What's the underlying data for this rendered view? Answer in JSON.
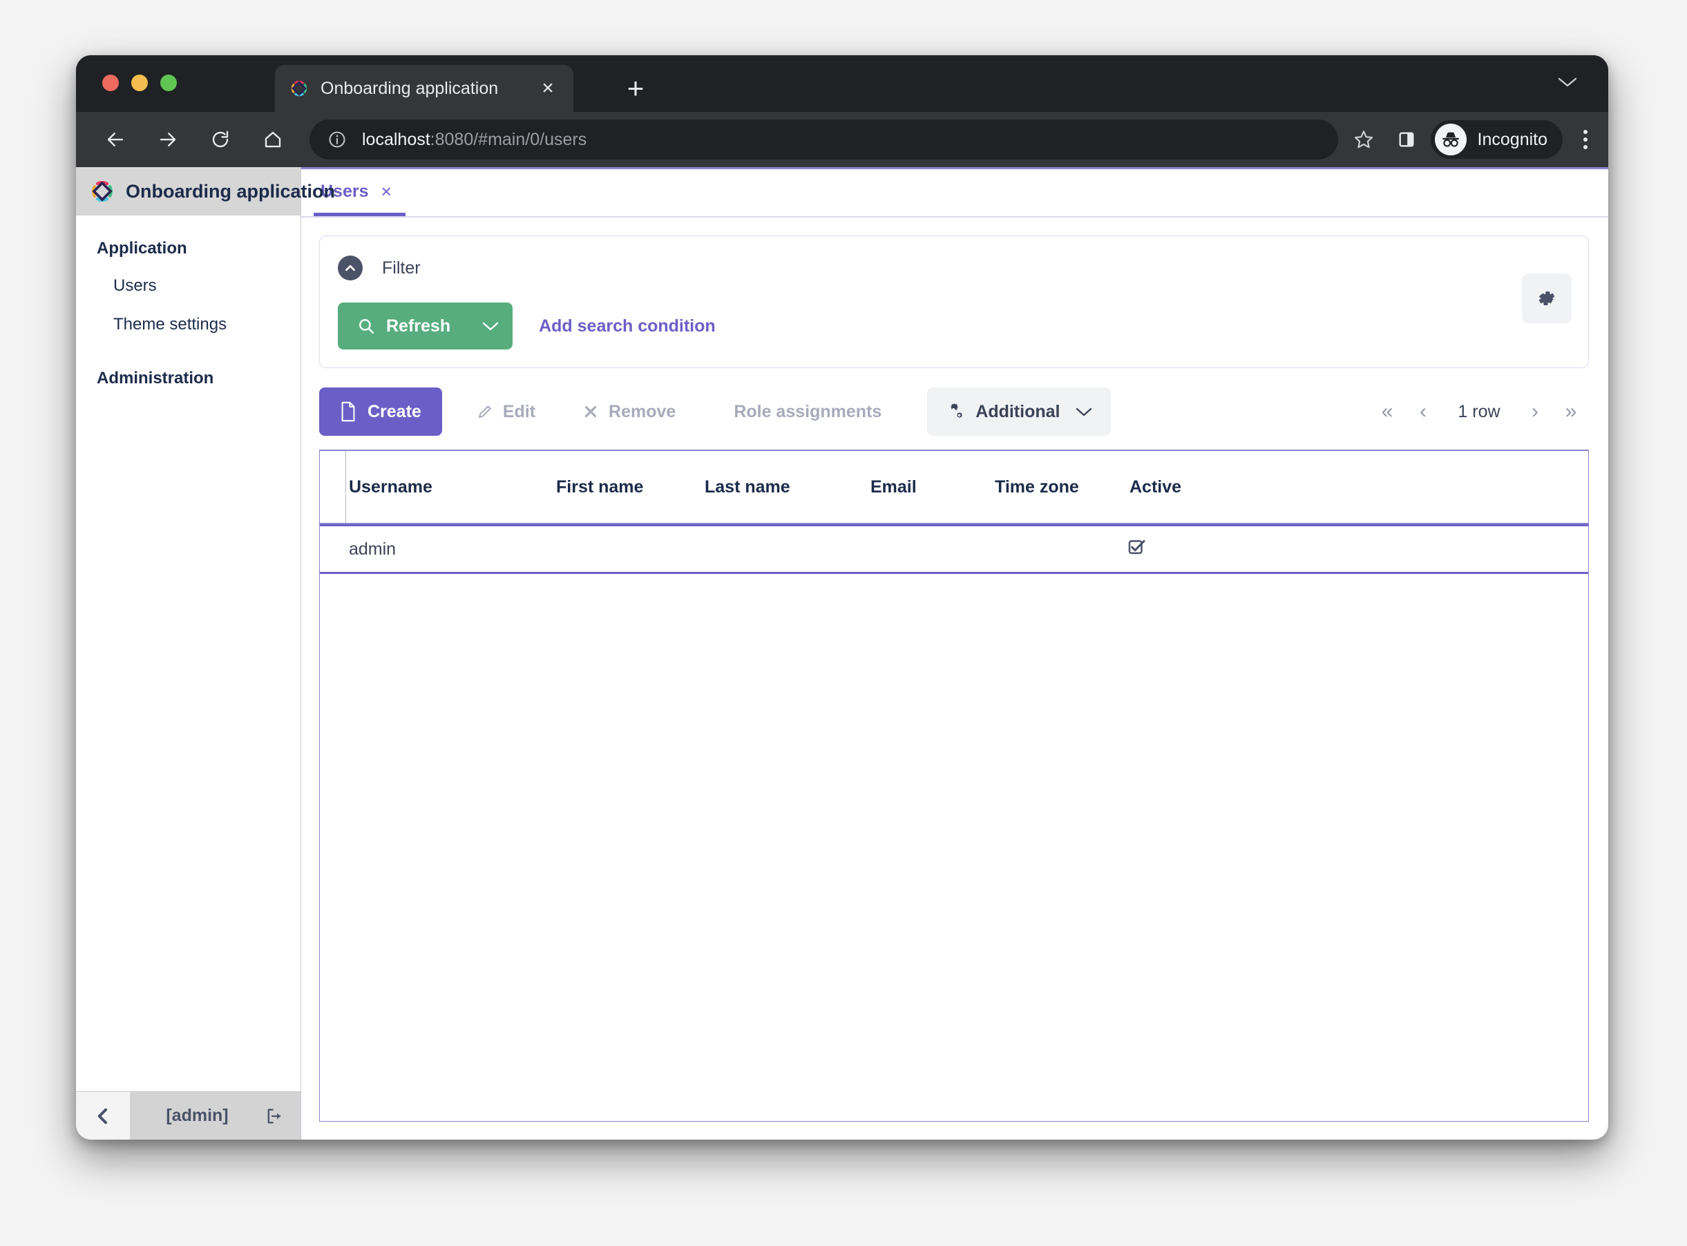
{
  "browser": {
    "tab": {
      "title": "Onboarding application",
      "close_label": "×",
      "favicon": "app-diamond-logo-icon"
    },
    "new_tab_label": "+",
    "tabstrip_menu_icon": "chevron-down-icon",
    "nav": {
      "back_icon": "back-arrow-icon",
      "forward_icon": "forward-arrow-icon",
      "reload_icon": "reload-icon",
      "home_icon": "home-icon"
    },
    "omnibox": {
      "info_icon": "site-info-icon",
      "url_host": "localhost",
      "url_rest": ":8080/#main/0/users",
      "url_full": "localhost:8080/#main/0/users"
    },
    "star_icon": "bookmark-star-icon",
    "split_icon": "side-panel-icon",
    "profile": {
      "label": "Incognito",
      "icon": "incognito-icon"
    },
    "menu_icon": "kebab-menu-icon"
  },
  "sidebar": {
    "app_title": "Onboarding application",
    "logo_icon": "app-diamond-logo-icon",
    "groups": [
      {
        "title": "Application",
        "items": [
          {
            "label": "Users"
          },
          {
            "label": "Theme settings"
          }
        ]
      },
      {
        "title": "Administration",
        "items": []
      }
    ],
    "footer": {
      "collapse_icon": "chevron-left-icon",
      "user_label": "[admin]",
      "logout_icon": "logout-icon"
    }
  },
  "content": {
    "tabs": [
      {
        "label": "Users",
        "close_label": "×",
        "active": true
      }
    ],
    "filter": {
      "title": "Filter",
      "collapse_icon": "chevron-up-circle-icon",
      "refresh_label": "Refresh",
      "refresh_icon": "search-icon",
      "refresh_caret_icon": "chevron-down-icon",
      "add_condition_label": "Add search condition",
      "settings_icon": "gear-icon"
    },
    "actions": {
      "create_label": "Create",
      "create_icon": "document-icon",
      "edit_label": "Edit",
      "edit_icon": "pencil-icon",
      "remove_label": "Remove",
      "remove_icon": "x-icon",
      "roles_label": "Role assignments",
      "additional_label": "Additional",
      "additional_icon": "gears-icon",
      "additional_caret_icon": "chevron-down-icon"
    },
    "pagination": {
      "first_label": "«",
      "prev_label": "‹",
      "rows_label": "1 row",
      "next_label": "›",
      "last_label": "»"
    },
    "table": {
      "columns": [
        "Username",
        "First name",
        "Last name",
        "Email",
        "Time zone",
        "Active"
      ],
      "rows": [
        {
          "username": "admin",
          "first_name": "",
          "last_name": "",
          "email": "",
          "time_zone": "",
          "active": true,
          "active_icon": "checkbox-checked-icon",
          "selected": true
        }
      ]
    }
  },
  "colors": {
    "accent_purple": "#6b5fc7",
    "accent_green": "#57ad7e",
    "navy_text": "#1c2b4a",
    "muted_text": "#a7abbb",
    "sidebar_header_bg": "#d6d6d6",
    "browser_chrome": "#35363a"
  }
}
